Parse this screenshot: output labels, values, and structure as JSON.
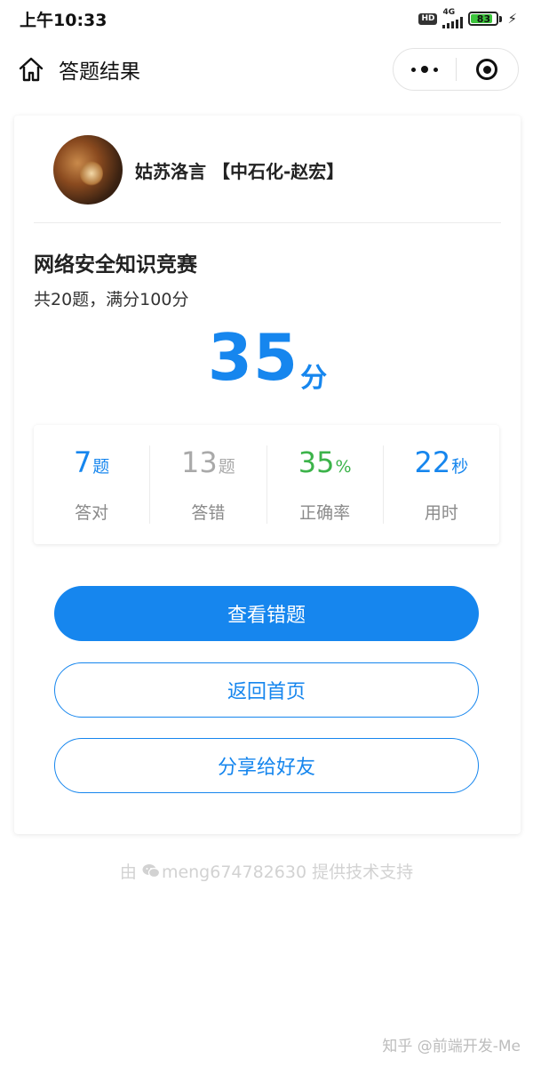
{
  "status_bar": {
    "time": "上午10:33",
    "hd_badge": "HD",
    "network": "4G",
    "battery": "83",
    "battery_level": 0.83
  },
  "nav": {
    "title": "答题结果",
    "icons": {
      "home": "home-icon",
      "more": "more-dots-icon",
      "close": "target-close-icon"
    }
  },
  "user": {
    "name": "姑苏洛言 【中石化-赵宏】"
  },
  "quiz": {
    "title": "网络安全知识竞赛",
    "subtitle": "共20题，满分100分",
    "score": "35",
    "score_unit": "分"
  },
  "stats": [
    {
      "value": "7",
      "unit": "题",
      "label": "答对",
      "color": "#1686ee"
    },
    {
      "value": "13",
      "unit": "题",
      "label": "答错",
      "color": "#a9a9a9"
    },
    {
      "value": "35",
      "unit": "%",
      "label": "正确率",
      "color": "#3cb34a"
    },
    {
      "value": "22",
      "unit": "秒",
      "label": "用时",
      "color": "#1686ee"
    }
  ],
  "buttons": {
    "review": "查看错题",
    "home": "返回首页",
    "share": "分享给好友"
  },
  "footer": {
    "prefix": "由",
    "contact": "meng674782630 提供技术支持",
    "watermark": "知乎 @前端开发-Me"
  },
  "colors": {
    "accent": "#1686ee",
    "correct_rate": "#3cb34a",
    "wrong": "#a9a9a9"
  }
}
